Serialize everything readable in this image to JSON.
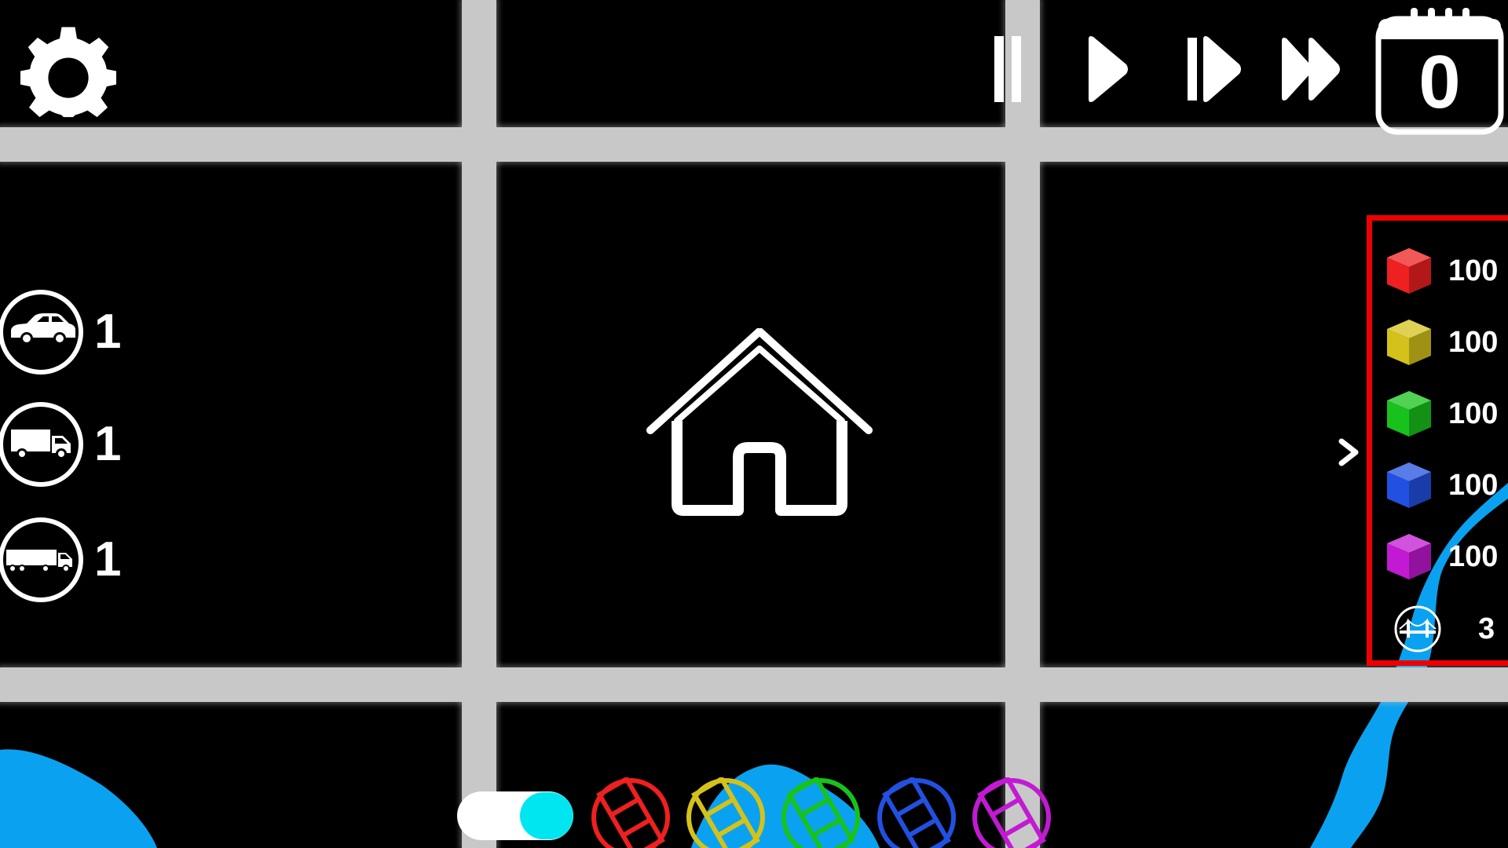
{
  "hud": {
    "day_counter": "0",
    "speed_controls": [
      {
        "name": "pause",
        "icon": "pause-icon"
      },
      {
        "name": "play",
        "icon": "play-icon"
      },
      {
        "name": "fast",
        "icon": "fast-forward-icon"
      },
      {
        "name": "fastest",
        "icon": "fastest-forward-icon"
      }
    ]
  },
  "vehicles": [
    {
      "icon": "car-icon",
      "count": "1"
    },
    {
      "icon": "truck-icon",
      "count": "1"
    },
    {
      "icon": "semi-truck-icon",
      "count": "1"
    }
  ],
  "resources": [
    {
      "icon": "red-cube-icon",
      "color": "#ee2020",
      "value": "100"
    },
    {
      "icon": "yellow-cube-icon",
      "color": "#d4c21a",
      "value": "100"
    },
    {
      "icon": "green-cube-icon",
      "color": "#18c21c",
      "value": "100"
    },
    {
      "icon": "blue-cube-icon",
      "color": "#2250e0",
      "value": "100"
    },
    {
      "icon": "purple-cube-icon",
      "color": "#c21ad2",
      "value": "100"
    }
  ],
  "bridges": {
    "icon": "bridge-icon",
    "count": "3"
  },
  "road_palette": [
    {
      "icon": "road-red-icon",
      "color": "#ee2020"
    },
    {
      "icon": "road-yellow-icon",
      "color": "#d4c21a"
    },
    {
      "icon": "road-green-icon",
      "color": "#18c21c"
    },
    {
      "icon": "road-blue-icon",
      "color": "#2250e0"
    },
    {
      "icon": "road-purple-icon",
      "color": "#c21ad2"
    }
  ],
  "colors": {
    "background": "#000000",
    "road": "#c8c8c8",
    "river": "#0aa2f0",
    "toggle_knob": "#00e6f0",
    "highlight": "#ee0000"
  }
}
